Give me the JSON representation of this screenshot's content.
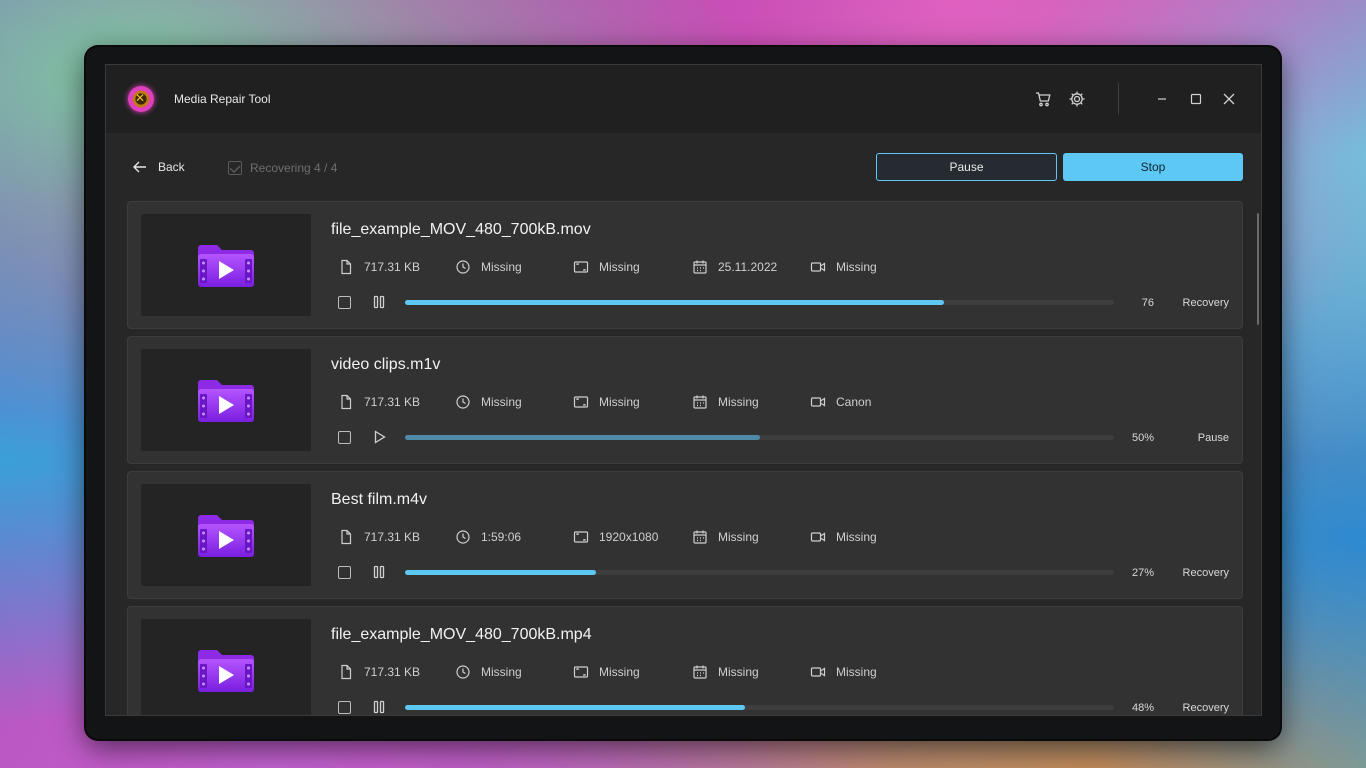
{
  "window": {
    "title": "Media Repair Tool"
  },
  "titlebar": {
    "icons": [
      "cart-icon",
      "gear-icon",
      "minimize-icon",
      "maximize-icon",
      "close-icon"
    ]
  },
  "toolbar": {
    "back_label": "Back",
    "status_label": "Recovering 4 / 4",
    "pause_label": "Pause",
    "stop_label": "Stop"
  },
  "colors": {
    "accent": "#5ec8f5",
    "paused_bar": "#4e8aa8",
    "background": "#272727"
  },
  "files": [
    {
      "name": "file_example_MOV_480_700kB.mov",
      "size": "717.31 KB",
      "duration": "Missing",
      "resolution": "Missing",
      "date": "25.11.2022",
      "camera": "Missing",
      "progress_pct": 76,
      "progress_label": "76",
      "state": "Recovery",
      "action": "pause"
    },
    {
      "name": "video clips.m1v",
      "size": "717.31 KB",
      "duration": "Missing",
      "resolution": "Missing",
      "date": "Missing",
      "camera": "Canon",
      "progress_pct": 50,
      "progress_label": "50%",
      "state": "Pause",
      "action": "play"
    },
    {
      "name": "Best film.m4v",
      "size": "717.31 KB",
      "duration": "1:59:06",
      "resolution": "1920x1080",
      "date": "Missing",
      "camera": "Missing",
      "progress_pct": 27,
      "progress_label": "27%",
      "state": "Recovery",
      "action": "pause"
    },
    {
      "name": "file_example_MOV_480_700kB.mp4",
      "size": "717.31 KB",
      "duration": "Missing",
      "resolution": "Missing",
      "date": "Missing",
      "camera": "Missing",
      "progress_pct": 48,
      "progress_label": "48%",
      "state": "Recovery",
      "action": "pause"
    }
  ]
}
